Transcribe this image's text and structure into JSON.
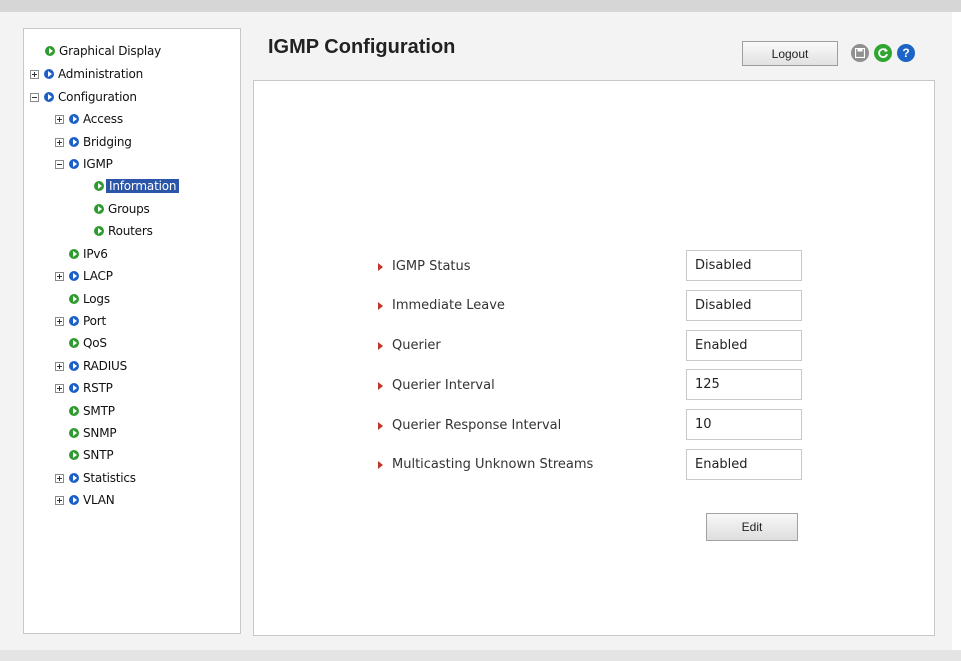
{
  "header": {
    "title": "IGMP Configuration",
    "logout_label": "Logout",
    "icons": [
      "save-icon",
      "refresh-icon",
      "help-icon"
    ],
    "help_glyph": "?"
  },
  "sidebar": {
    "items": [
      {
        "label": "Graphical Display",
        "expander": "none",
        "bullet": "green"
      },
      {
        "label": "Administration",
        "expander": "plus",
        "bullet": "blue"
      },
      {
        "label": "Configuration",
        "expander": "minus",
        "bullet": "blue"
      },
      {
        "label": "Access",
        "expander": "plus",
        "bullet": "blue"
      },
      {
        "label": "Bridging",
        "expander": "plus",
        "bullet": "blue"
      },
      {
        "label": "IGMP",
        "expander": "minus",
        "bullet": "blue"
      },
      {
        "label": "Information",
        "expander": "none",
        "bullet": "green",
        "selected": true
      },
      {
        "label": "Groups",
        "expander": "none",
        "bullet": "green"
      },
      {
        "label": "Routers",
        "expander": "none",
        "bullet": "green"
      },
      {
        "label": "IPv6",
        "expander": "none",
        "bullet": "green"
      },
      {
        "label": "LACP",
        "expander": "plus",
        "bullet": "blue"
      },
      {
        "label": "Logs",
        "expander": "none",
        "bullet": "green"
      },
      {
        "label": "Port",
        "expander": "plus",
        "bullet": "blue"
      },
      {
        "label": "QoS",
        "expander": "none",
        "bullet": "green"
      },
      {
        "label": "RADIUS",
        "expander": "plus",
        "bullet": "blue"
      },
      {
        "label": "RSTP",
        "expander": "plus",
        "bullet": "blue"
      },
      {
        "label": "SMTP",
        "expander": "none",
        "bullet": "green"
      },
      {
        "label": "SNMP",
        "expander": "none",
        "bullet": "green"
      },
      {
        "label": "SNTP",
        "expander": "none",
        "bullet": "green"
      },
      {
        "label": "Statistics",
        "expander": "plus",
        "bullet": "blue"
      },
      {
        "label": "VLAN",
        "expander": "plus",
        "bullet": "blue"
      }
    ]
  },
  "form": {
    "fields": [
      {
        "label": "IGMP Status",
        "value": "Disabled"
      },
      {
        "label": "Immediate Leave",
        "value": "Disabled"
      },
      {
        "label": "Querier",
        "value": "Enabled"
      },
      {
        "label": "Querier Interval",
        "value": "125"
      },
      {
        "label": "Querier Response Interval",
        "value": "10"
      },
      {
        "label": "Multicasting Unknown Streams",
        "value": "Enabled"
      }
    ],
    "edit_label": "Edit"
  },
  "colors": {
    "selected_bg": "#2a55a8",
    "bullet_green": "#2f9a2f",
    "bullet_blue": "#1c5fc6",
    "arrow_red": "#c0352b"
  }
}
